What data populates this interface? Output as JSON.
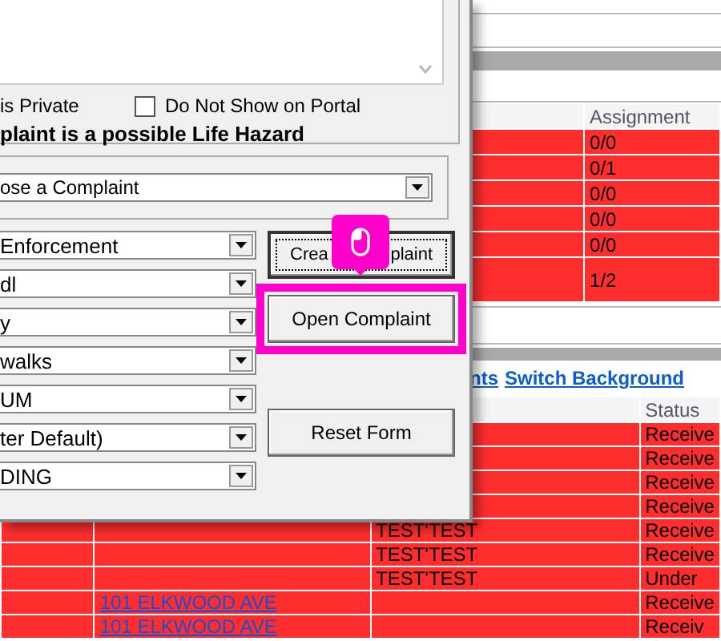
{
  "complaint_form": {
    "private_label": "is Private",
    "portal_checkbox": {
      "label": "Do Not Show on Portal",
      "checked": false
    },
    "life_hazard_label": "plaint is a possible Life Hazard",
    "complaint_type": {
      "value": "ose a Complaint"
    },
    "dropdowns": [
      {
        "value": "Enforcement"
      },
      {
        "value": "dl"
      },
      {
        "value": "y"
      },
      {
        "value": "walks"
      },
      {
        "value": "UM"
      },
      {
        "value": "ter Default)"
      },
      {
        "value": "DING"
      }
    ],
    "buttons": [
      {
        "label_parts": [
          "Crea",
          "plaint"
        ],
        "focused": true,
        "highlighted": false
      },
      {
        "label_parts": [
          "Open Complaint"
        ],
        "focused": false,
        "highlighted": true
      },
      {
        "label_parts": [
          "Reset Form"
        ],
        "focused": false,
        "highlighted": false
      }
    ]
  },
  "assignment_table": {
    "column_header": "Assignment",
    "rows": [
      {
        "assignment": "0/0"
      },
      {
        "assignment": "0/1"
      },
      {
        "assignment": "0/0"
      },
      {
        "assignment": "0/0"
      },
      {
        "assignment": "0/0"
      },
      {
        "assignment": "1/2"
      }
    ]
  },
  "links": [
    "nts",
    "Switch Background"
  ],
  "complaints_table": {
    "column_header": "Status",
    "rows": [
      {
        "status": "Receive"
      },
      {
        "status": "Receive"
      },
      {
        "status": "Receive"
      },
      {
        "status": "Receive"
      },
      {
        "name": "TEST'TEST",
        "status": "Receive"
      },
      {
        "name": "TEST'TEST",
        "status": "Receive"
      },
      {
        "name": "TEST'TEST",
        "status": "Under"
      },
      {
        "address": "101 ELKWOOD AVE",
        "status": "Receive"
      },
      {
        "address": "101 ELKWOOD AVE",
        "status": "Receiv"
      }
    ]
  }
}
